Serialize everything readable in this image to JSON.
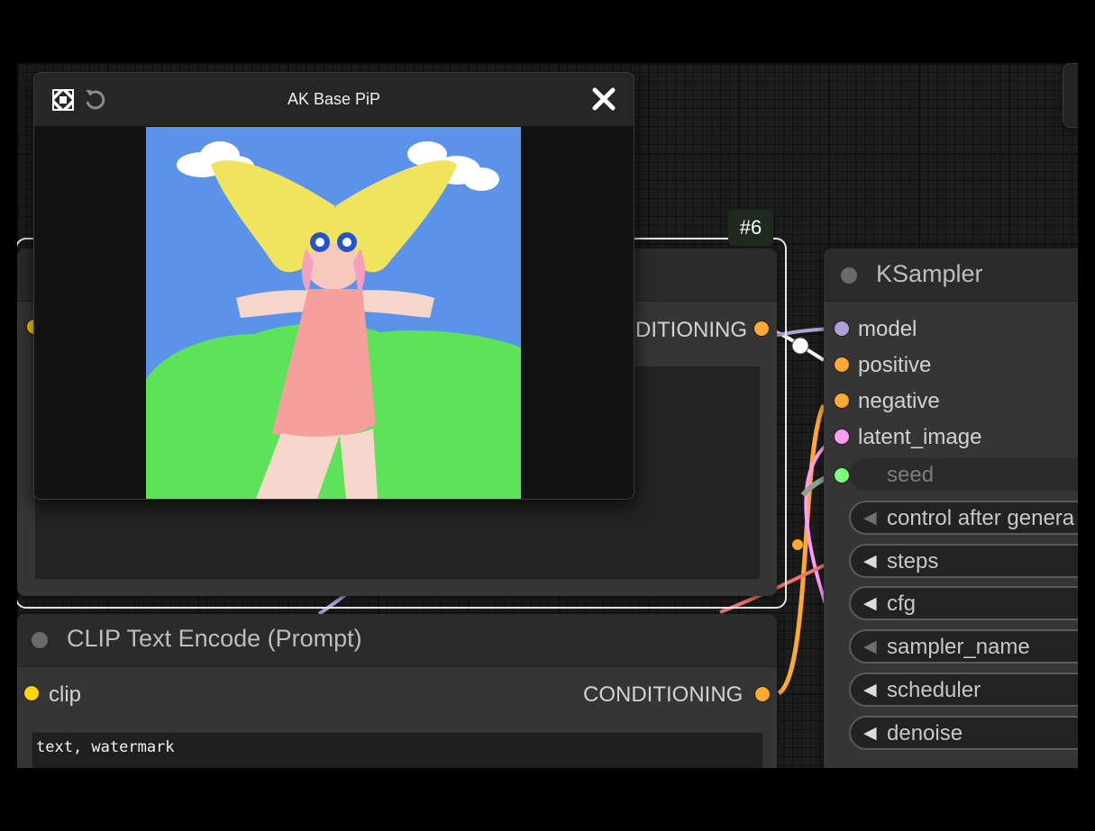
{
  "pip": {
    "title": "AK Base PiP",
    "expand_icon": "expand-arrows-icon",
    "reset_icon": "rotate-ccw-icon",
    "close_icon": "close-icon"
  },
  "node_badge": "#6",
  "positive_node": {
    "output_label": "DITIONING"
  },
  "clip_node": {
    "title": "CLIP Text Encode (Prompt)",
    "input_label": "clip",
    "output_label": "CONDITIONING",
    "text_value": "text, watermark"
  },
  "ksampler": {
    "title": "KSampler",
    "inputs": [
      "model",
      "positive",
      "negative",
      "latent_image"
    ],
    "seed_label": "seed",
    "widgets": [
      "control after genera",
      "steps",
      "cfg",
      "sampler_name",
      "scheduler",
      "denoise"
    ]
  },
  "colors": {
    "model_slot": "#b39ddb",
    "conditioning_slot": "#ffa931",
    "latent_slot": "#ff9cf9",
    "int_slot": "#7cfc7c",
    "clip_slot": "#ffd500",
    "selected_outline": "#e6e6e6"
  }
}
